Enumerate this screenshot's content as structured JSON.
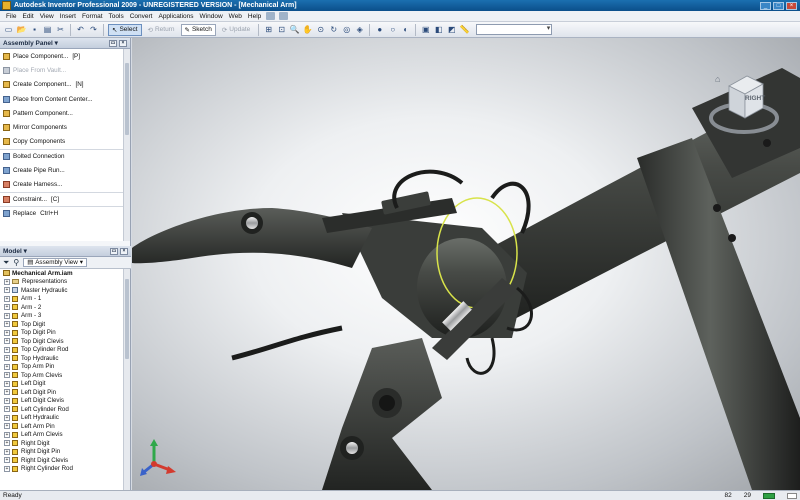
{
  "window": {
    "title": "Autodesk Inventor Professional 2009 - UNREGISTERED VERSION - [Mechanical Arm]"
  },
  "menu": [
    "File",
    "Edit",
    "View",
    "Insert",
    "Format",
    "Tools",
    "Convert",
    "Applications",
    "Window",
    "Web",
    "Help"
  ],
  "toolbar": {
    "select_label": "Select",
    "return_label": "Return",
    "sketch_label": "Sketch",
    "update_label": "Update"
  },
  "assembly_panel": {
    "title": "Assembly Panel",
    "items": [
      {
        "label": "Place Component...",
        "shortcut": "[P]",
        "enabled": true
      },
      {
        "label": "Place From Vault...",
        "shortcut": "",
        "enabled": false
      },
      {
        "label": "Create Component...",
        "shortcut": "[N]",
        "enabled": true
      },
      {
        "label": "Place from Content Center...",
        "shortcut": "",
        "enabled": true
      },
      {
        "label": "Pattern Component...",
        "shortcut": "",
        "enabled": true
      },
      {
        "label": "Mirror Components",
        "shortcut": "",
        "enabled": true
      },
      {
        "label": "Copy Components",
        "shortcut": "",
        "enabled": true
      },
      {
        "label": "Bolted Connection",
        "shortcut": "",
        "enabled": true
      },
      {
        "label": "Create Pipe Run...",
        "shortcut": "",
        "enabled": true
      },
      {
        "label": "Create Harness...",
        "shortcut": "",
        "enabled": true
      },
      {
        "label": "Constraint...",
        "shortcut": "[C]",
        "enabled": true
      },
      {
        "label": "Replace",
        "shortcut": "Ctrl+H",
        "enabled": true
      }
    ]
  },
  "model_panel": {
    "title": "Model",
    "view_label": "Assembly View",
    "root": "Mechanical Arm.iam",
    "items": [
      "Representations",
      "Master Hydraulic",
      "Arm - 1",
      "Arm - 2",
      "Arm - 3",
      "Top Digit",
      "Top Digit Pin",
      "Top Digit Clevis",
      "Top Cylinder Rod",
      "Top Hydraulic",
      "Top Arm Pin",
      "Top Arm Clevis",
      "Left Digit",
      "Left Digit Pin",
      "Left Digit Clevis",
      "Left Cylinder Rod",
      "Left Hydraulic",
      "Left Arm Pin",
      "Left Arm Clevis",
      "Right Digit",
      "Right Digit Pin",
      "Right Digit Clevis",
      "Right Cylinder Rod"
    ]
  },
  "viewcube": {
    "face_label": "RIGHT"
  },
  "statusbar": {
    "status": "Ready",
    "count_a": "82",
    "count_b": "29"
  },
  "colors": {
    "title_bar": "#0b4f8a",
    "model_body": "#3b3e3b",
    "highlight": "#d8e34a"
  }
}
